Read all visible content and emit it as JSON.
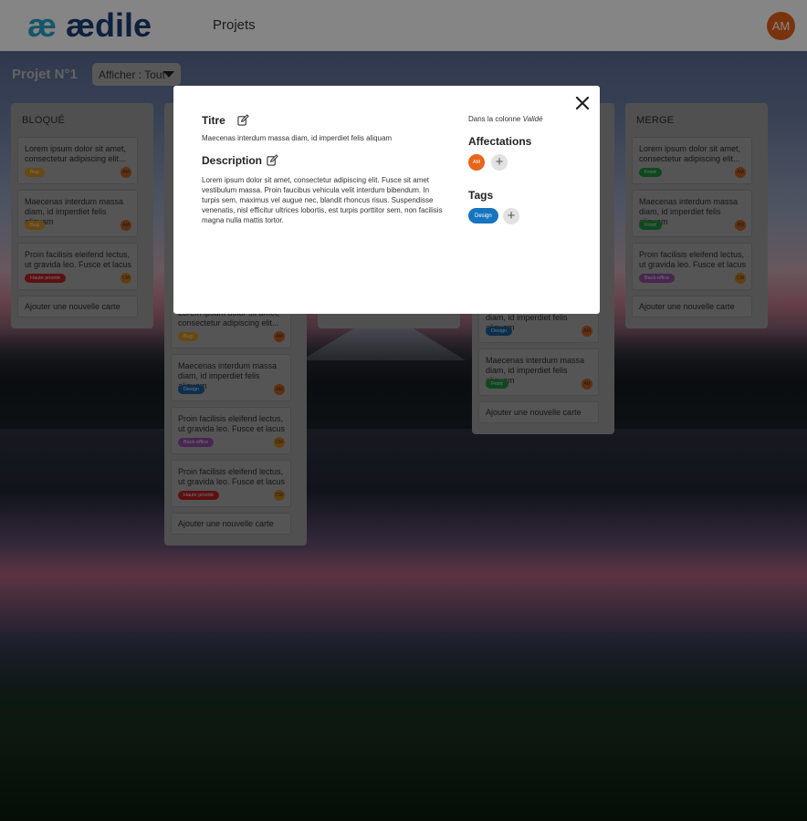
{
  "header": {
    "logo_mark": "æ",
    "logo_text": "ædile",
    "nav_label": "Projets",
    "user_initials": "AM"
  },
  "project": {
    "title": "Projet N°1",
    "filter_label": "Afficher : Tout"
  },
  "columns": [
    {
      "title": "BLOQUÉ",
      "cards": [
        {
          "text": "Lorem ipsum dolor sit amet, consectetur adipiscing elit...",
          "tag": "Bug",
          "tag_color": "#c98a21",
          "avatar": "AM",
          "avatar_color": "#b65a22"
        },
        {
          "text": "Maecenas interdum massa diam, id imperdiet felis aliquam",
          "tag": "Bug",
          "tag_color": "#c98a21",
          "avatar": "AM",
          "avatar_color": "#b65a22"
        },
        {
          "text": "Proin facilisis eleifend lectus, ut gravida leo. Fusce et lacus ...",
          "tag": "Haute priorité",
          "tag_color": "#b32021",
          "avatar": "CM",
          "avatar_color": "#b97a22"
        }
      ],
      "add_label": "Ajouter une nouvelle carte"
    },
    {
      "title": "",
      "cards": [
        {
          "text": "Lorem ipsum dolor sit amet, consectetur adipiscing elit...",
          "tag": "Bug",
          "tag_color": "#c98a21",
          "avatar": "AM",
          "avatar_color": "#b65a22"
        },
        {
          "text": "Maecenas interdum massa diam, id imperdiet felis aliquam",
          "tag": "Design",
          "tag_color": "#175b94",
          "avatar": "AM",
          "avatar_color": "#b65a22"
        },
        {
          "text": "Proin facilisis eleifend lectus, ut gravida leo. Fusce et lacus ...",
          "tag": "Back-office",
          "tag_color": "#8a4a9a",
          "avatar": "CM",
          "avatar_color": "#b97a22"
        },
        {
          "text": "Proin facilisis eleifend lectus, ut gravida leo. Fusce et lacus ...",
          "tag": "Haute priorité",
          "tag_color": "#b32021",
          "avatar": "CM",
          "avatar_color": "#b97a22"
        }
      ],
      "add_label": "Ajouter une nouvelle carte"
    },
    {
      "title": "",
      "cards": [],
      "add_label": ""
    },
    {
      "title": "",
      "cards": [
        {
          "text": "Maecenas interdum massa diam, id imperdiet felis aliquam",
          "tag": "Design",
          "tag_color": "#175b94",
          "avatar": "AM",
          "avatar_color": "#b65a22"
        },
        {
          "text": "Maecenas interdum massa diam, id imperdiet felis aliquam",
          "tag": "Front",
          "tag_color": "#1e8a3c",
          "avatar": "AM",
          "avatar_color": "#b65a22"
        }
      ],
      "add_label": "Ajouter une nouvelle carte"
    },
    {
      "title": "MERGE",
      "cards": [
        {
          "text": "Lorem ipsum dolor sit amet, consectetur adipiscing elit...",
          "tag": "Front",
          "tag_color": "#1e8a3c",
          "avatar": "AM",
          "avatar_color": "#b65a22"
        },
        {
          "text": "Maecenas interdum massa diam, id imperdiet felis aliquam",
          "tag": "Front",
          "tag_color": "#1e8a3c",
          "avatar": "AM",
          "avatar_color": "#b65a22"
        },
        {
          "text": "Proin facilisis eleifend lectus, ut gravida leo. Fusce et lacus ...",
          "tag": "Back-office",
          "tag_color": "#8a4a9a",
          "avatar": "CM",
          "avatar_color": "#b97a22"
        }
      ],
      "add_label": "Ajouter une nouvelle carte"
    }
  ],
  "modal": {
    "title_heading": "Titre",
    "title_value": "Maecenas interdum massa diam, id imperdiet felis aliquam",
    "description_heading": "Description",
    "description_value": "Lorem ipsum dolor sit amet, consectetur adipiscing elit. Fusce sit amet vestibulum massa. Proin faucibus vehicula velit interdum bibendum. In turpis sem, maximus vel augue nec, blandit rhoncus risus. Suspendisse venenatis, nisl efficitur ultrices lobortis, est turpis porttitor sem, non facilisis magna nulla mattis tortor.",
    "column_prefix": "Dans la colonne",
    "column_name": "Validé",
    "affectations_heading": "Affectations",
    "assignee_initials": "AM",
    "tags_heading": "Tags",
    "tag": "Design",
    "close_icon": "close-icon",
    "edit_icon": "edit-icon"
  }
}
